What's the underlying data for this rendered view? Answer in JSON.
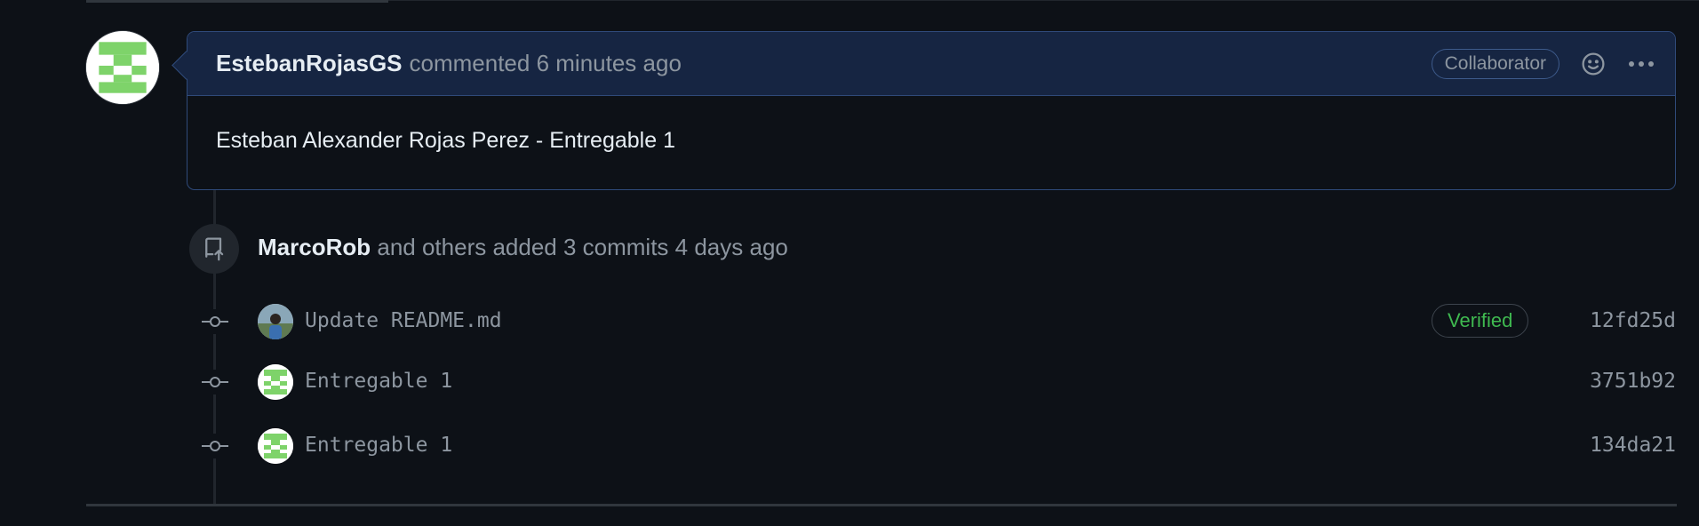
{
  "comment": {
    "author": "EstebanRojasGS",
    "action_time": "commented 6 minutes ago",
    "role_badge": "Collaborator",
    "body": "Esteban Alexander Rojas Perez - Entregable 1"
  },
  "icons": {
    "reaction": "smiley-icon",
    "more": "kebab-horizontal-icon",
    "push": "repo-push-icon",
    "commit": "git-commit-icon"
  },
  "summary": {
    "user": "MarcoRob",
    "text": "and others added 3 commits 4 days ago"
  },
  "commits": [
    {
      "message": "Update README.md",
      "verified_label": "Verified",
      "sha": "12fd25d"
    },
    {
      "message": "Entregable 1",
      "sha": "3751b92"
    },
    {
      "message": "Entregable 1",
      "sha": "134da21"
    }
  ],
  "colors": {
    "background": "#0d1117",
    "header_bg": "#162542",
    "border_accent": "#2f4a7a",
    "verified_green": "#3fb950",
    "avatar_green": "#7ed36a"
  }
}
